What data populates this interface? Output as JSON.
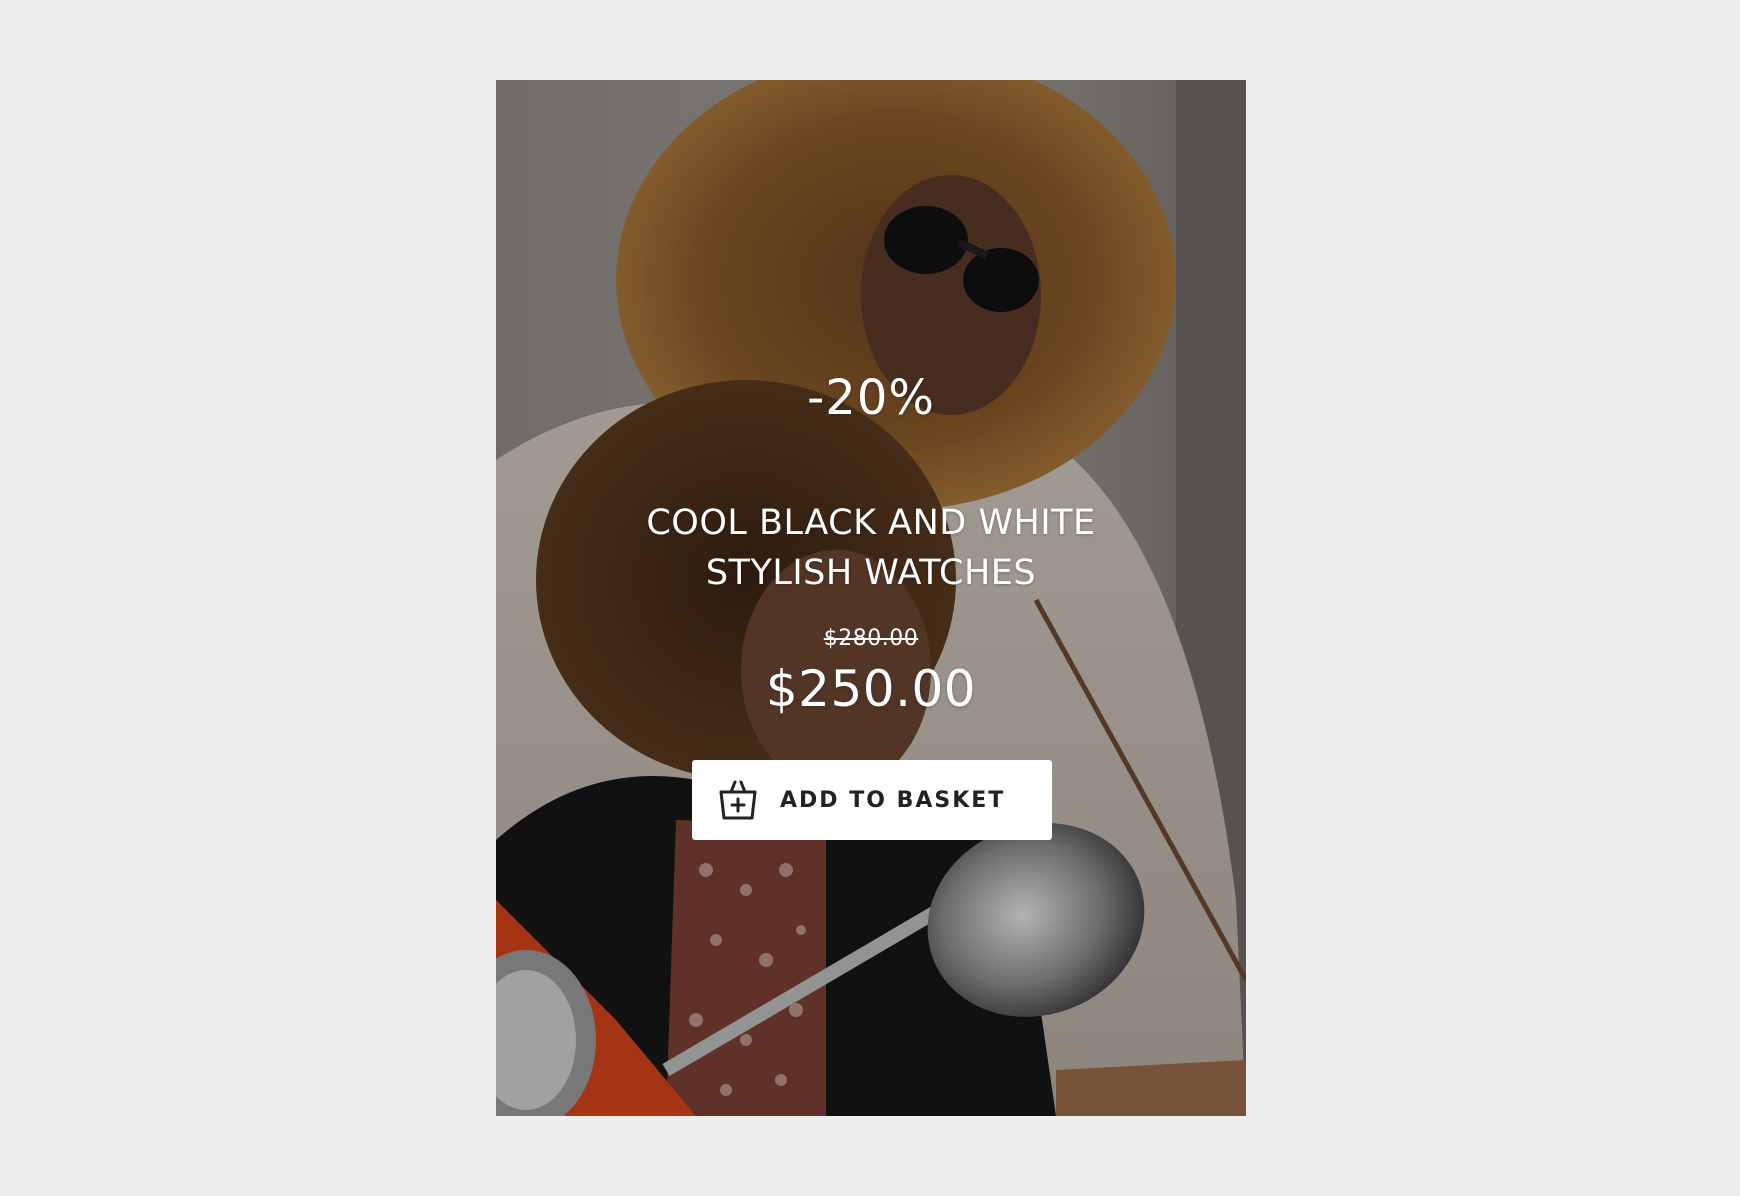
{
  "card": {
    "discount": "-20%",
    "title": "COOL BLACK AND WHITE STYLISH WATCHES",
    "old_price": "$280.00",
    "price": "$250.00",
    "add_to_basket_label": "ADD TO BASKET",
    "basket_icon": "basket-add-icon"
  },
  "colors": {
    "page_background": "#eeeeee",
    "button_background": "#ffffff",
    "button_text": "#222222",
    "text_on_image": "#ffffff"
  }
}
